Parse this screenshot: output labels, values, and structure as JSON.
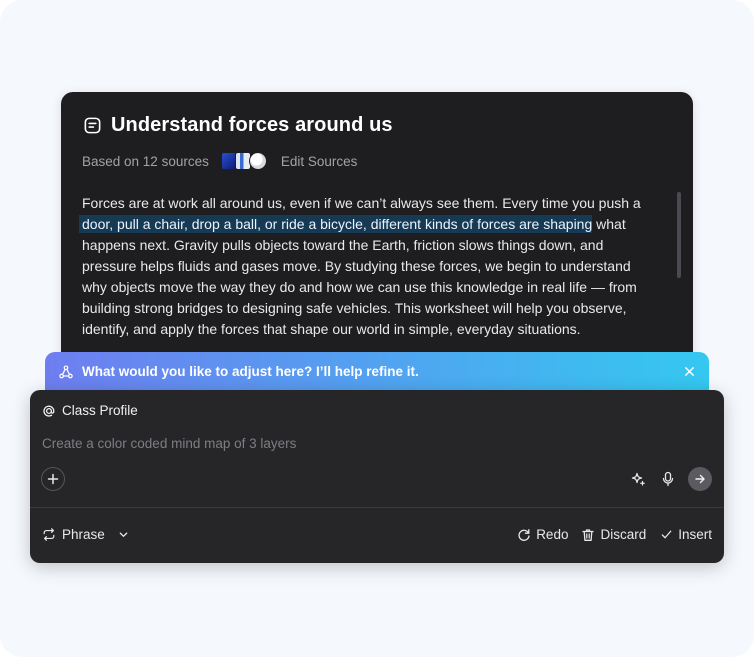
{
  "document": {
    "title": "Understand forces around us",
    "sources_label": "Based on 12 sources",
    "edit_sources_label": "Edit Sources",
    "body_before": "Forces are at work all around us, even if we can’t always see them. Every time you push a ",
    "body_highlight": "door, pull a chair, drop a ball, or ride a bicycle, different kinds of forces are shaping",
    "body_after": " what happens next. Gravity pulls objects toward the Earth, friction slows things down, and pressure helps fluids and gases move. By studying these forces, we begin to understand why objects move the way they do and how we can use this knowledge in real life — from building strong bridges to designing safe vehicles. This worksheet will help you observe, identify, and apply the forces that shape our world in simple, everyday situations."
  },
  "prompt": {
    "text": "What would you like to adjust here? I’ll help refine it."
  },
  "composer": {
    "profile_label": "Class Profile",
    "input_value": "",
    "input_placeholder": "Create a color coded mind map of 3 layers"
  },
  "footer": {
    "phrase_label": "Phrase",
    "redo_label": "Redo",
    "discard_label": "Discard",
    "insert_label": "Insert"
  },
  "colors": {
    "page_bg": "#f5f8fd",
    "card_bg": "#1e1e20",
    "composer_bg": "#262628",
    "highlight_bg": "#163954",
    "prompt_gradient_start": "#6e7ef0",
    "prompt_gradient_end": "#34c8f0"
  },
  "icons": {
    "title_icon": "document-icon",
    "prompt_icon": "hierarchy-icon",
    "profile_icon": "at-sign-icon"
  }
}
